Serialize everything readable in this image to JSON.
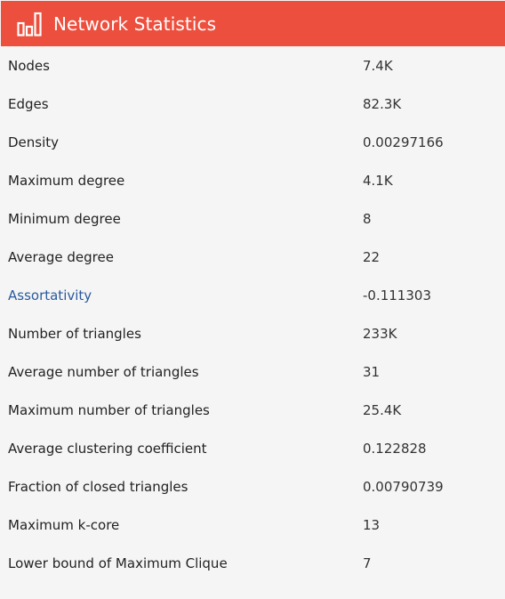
{
  "header": {
    "title": "Network Statistics",
    "icon": "bar-chart-icon",
    "color": "#ed4f3e"
  },
  "link_color": "#2a5a9e",
  "stats": [
    {
      "label": "Nodes",
      "value": "7.4K",
      "link": false
    },
    {
      "label": "Edges",
      "value": "82.3K",
      "link": false
    },
    {
      "label": "Density",
      "value": "0.00297166",
      "link": false
    },
    {
      "label": "Maximum degree",
      "value": "4.1K",
      "link": false
    },
    {
      "label": "Minimum degree",
      "value": "8",
      "link": false
    },
    {
      "label": "Average degree",
      "value": "22",
      "link": false
    },
    {
      "label": "Assortativity",
      "value": "-0.111303",
      "link": true
    },
    {
      "label": "Number of triangles",
      "value": "233K",
      "link": false
    },
    {
      "label": "Average number of triangles",
      "value": "31",
      "link": false
    },
    {
      "label": "Maximum number of triangles",
      "value": "25.4K",
      "link": false
    },
    {
      "label": "Average clustering coefficient",
      "value": "0.122828",
      "link": false
    },
    {
      "label": "Fraction of closed triangles",
      "value": "0.00790739",
      "link": false
    },
    {
      "label": "Maximum k-core",
      "value": "13",
      "link": false
    },
    {
      "label": "Lower bound of Maximum Clique",
      "value": "7",
      "link": false
    }
  ]
}
